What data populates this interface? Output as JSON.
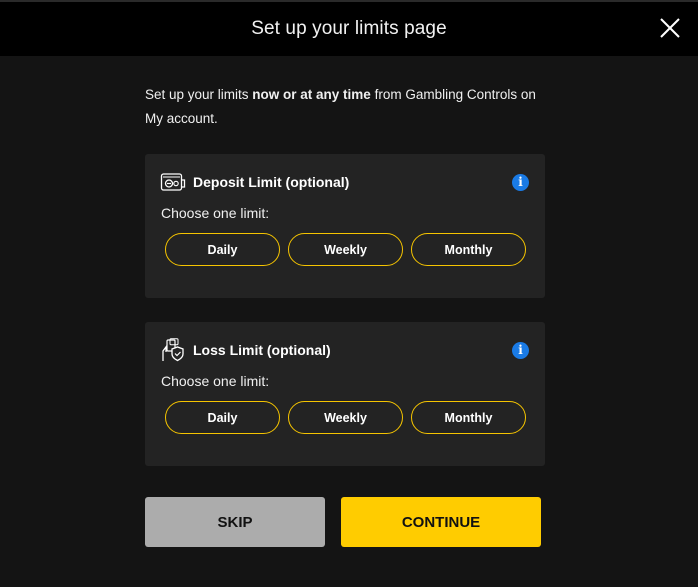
{
  "header": {
    "title": "Set up your limits page",
    "close_icon": "close-icon"
  },
  "intro": {
    "text_before": "Set up your limits ",
    "text_bold": "now or at any time",
    "text_after": " from Gambling Controls on My account."
  },
  "cards": [
    {
      "title": "Deposit Limit (optional)",
      "icon": "wallet-icon",
      "info_icon": "info-icon",
      "info_symbol": "i",
      "prompt": "Choose one limit:",
      "options": [
        "Daily",
        "Weekly",
        "Monthly"
      ]
    },
    {
      "title": "Loss Limit (optional)",
      "icon": "hand-shield-icon",
      "info_icon": "info-icon",
      "info_symbol": "i",
      "prompt": "Choose one limit:",
      "options": [
        "Daily",
        "Weekly",
        "Monthly"
      ]
    }
  ],
  "actions": {
    "skip_label": "SKIP",
    "continue_label": "CONTINUE"
  },
  "colors": {
    "accent": "#ffcc00",
    "pill_border": "#f5c400",
    "info": "#1a7be6",
    "skip": "#acacac",
    "card_bg": "#232323",
    "page_bg": "#141414",
    "header_bg": "#000000"
  }
}
